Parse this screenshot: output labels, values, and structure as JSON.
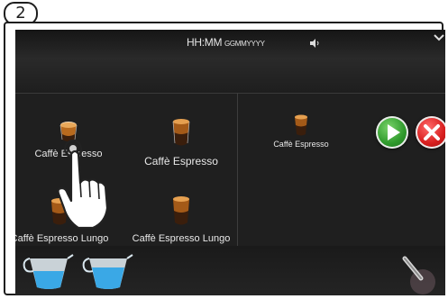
{
  "step": "2",
  "statusbar": {
    "time": "HH:MM",
    "date": "GGMMYYYY"
  },
  "beverages": [
    {
      "label": "Caffè Espresso"
    },
    {
      "label": "Caffè Espresso"
    },
    {
      "label": "Caffè Espresso"
    },
    {
      "label": "Caffè Espresso Lungo"
    },
    {
      "label": "Caffè Espresso Lungo"
    }
  ],
  "icons": {
    "volume": "speaker-icon",
    "chevron": "chevron-down-icon",
    "start": "play-icon",
    "cancel": "close-icon",
    "hand": "pointing-hand-icon",
    "jug": "milk-jug-icon",
    "steam": "steam-wand-icon"
  },
  "colors": {
    "start_button": "#2f9a2c",
    "cancel_button": "#d81e1e",
    "water": "#3aa8e6"
  }
}
